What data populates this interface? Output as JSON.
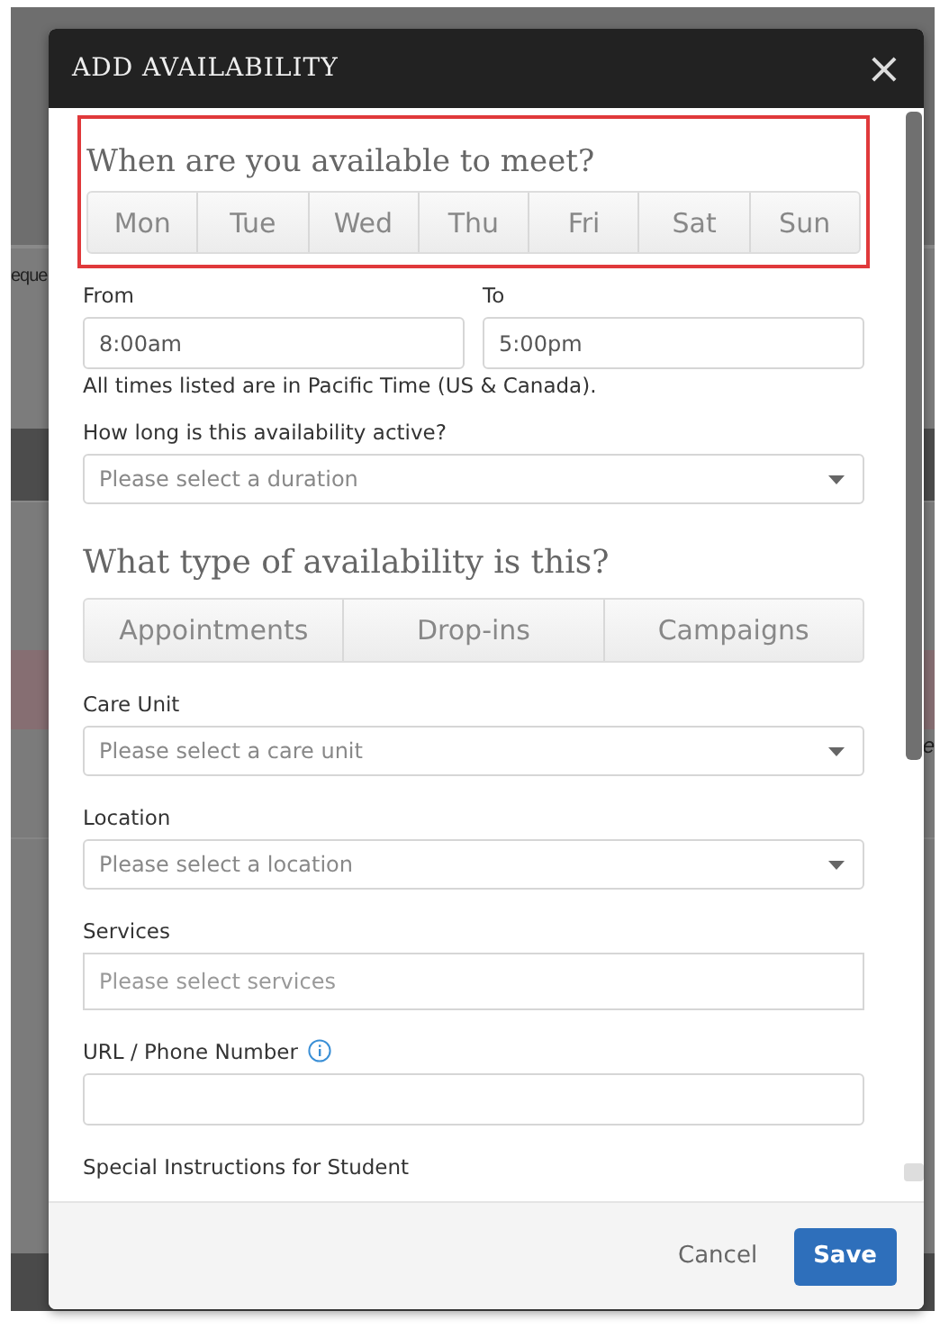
{
  "background": {
    "left_text": "eque",
    "right_text": "e"
  },
  "dialog": {
    "title": "ADD AVAILABILITY",
    "close": "×"
  },
  "days_section": {
    "heading": "When are you available to meet?",
    "highlighted": true,
    "days": [
      {
        "label": "Mon",
        "selected": false
      },
      {
        "label": "Tue",
        "selected": false
      },
      {
        "label": "Wed",
        "selected": false
      },
      {
        "label": "Thu",
        "selected": false
      },
      {
        "label": "Fri",
        "selected": false
      },
      {
        "label": "Sat",
        "selected": false
      },
      {
        "label": "Sun",
        "selected": false
      }
    ]
  },
  "time": {
    "from_label": "From",
    "from_value": "8:00am",
    "to_label": "To",
    "to_value": "5:00pm",
    "note": "All times listed are in Pacific Time (US & Canada)."
  },
  "duration": {
    "label": "How long is this availability active?",
    "placeholder": "Please select a duration"
  },
  "type_section": {
    "heading": "What type of availability is this?",
    "types": [
      {
        "label": "Appointments",
        "selected": false
      },
      {
        "label": "Drop-ins",
        "selected": false
      },
      {
        "label": "Campaigns",
        "selected": false
      }
    ]
  },
  "fields": [
    {
      "kind": "select",
      "label": "Care Unit",
      "placeholder": "Please select a care unit"
    },
    {
      "kind": "select",
      "label": "Location",
      "placeholder": "Please select a location"
    },
    {
      "kind": "multi",
      "label": "Services",
      "placeholder": "Please select services"
    },
    {
      "kind": "text",
      "label": "URL / Phone Number",
      "info": true
    },
    {
      "kind": "heading",
      "label": "Special Instructions for Student"
    }
  ],
  "footer": {
    "cancel": "Cancel",
    "save": "Save"
  }
}
